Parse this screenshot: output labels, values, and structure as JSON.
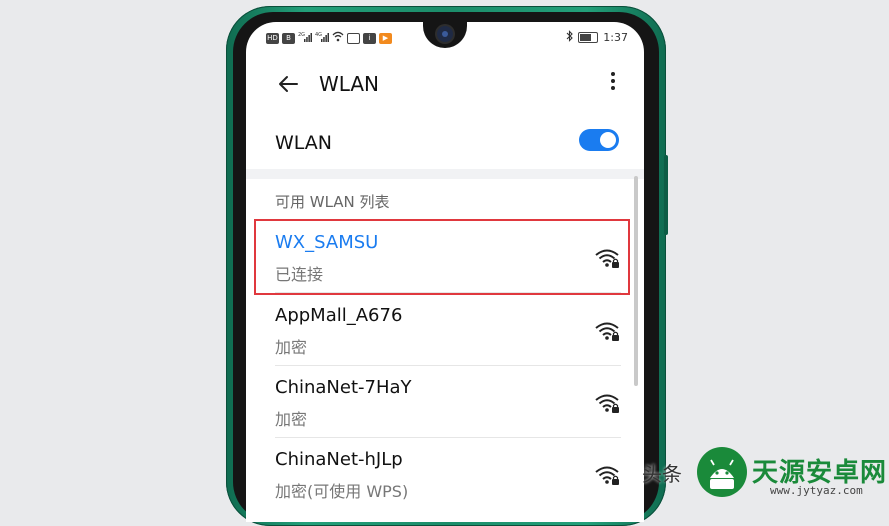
{
  "status_bar": {
    "left_icons": [
      "HD",
      "B",
      "2G",
      "4G",
      "wifi",
      "img",
      "i",
      "play"
    ],
    "time": "1:37"
  },
  "header": {
    "back_icon": "arrow-left-icon",
    "title": "WLAN",
    "more_icon": "more-vert-icon"
  },
  "wlan_toggle": {
    "label": "WLAN",
    "on": true
  },
  "section_label": "可用 WLAN 列表",
  "networks": [
    {
      "name": "WX_SAMSU",
      "status": "已连接",
      "icon": "wifi-locked-icon",
      "connected": true
    },
    {
      "name": "AppMall_A676",
      "status": "加密",
      "icon": "wifi-locked-icon",
      "connected": false
    },
    {
      "name": "ChinaNet-7HaY",
      "status": "加密",
      "icon": "wifi-locked-icon",
      "connected": false
    },
    {
      "name": "ChinaNet-hJLp",
      "status": "加密(可使用 WPS)",
      "icon": "wifi-locked-icon",
      "connected": false
    }
  ],
  "watermark": {
    "left_text": "头条",
    "site_name": "天源安卓网",
    "site_url": "www.jytyaz.com"
  },
  "colors": {
    "accent": "#1a7cf0",
    "highlight": "#e0383e",
    "phone_body": "#1c8d6a"
  }
}
